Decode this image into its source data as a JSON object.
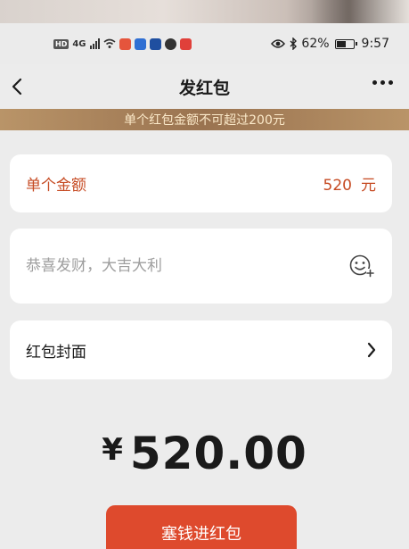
{
  "status_bar": {
    "left_tags": [
      "HD"
    ],
    "network": "4G",
    "battery_percent": "62%",
    "battery_level": 0.62,
    "time": "9:57"
  },
  "nav": {
    "title": "发红包",
    "back_icon": "chevron-left-icon",
    "more_icon": "more-dots-icon"
  },
  "notice": {
    "text": "单个红包金额不可超过200元"
  },
  "amount": {
    "label": "单个金额",
    "value": "520",
    "unit": "元"
  },
  "greeting": {
    "placeholder": "恭喜发财，大吉大利",
    "emoji_icon": "emoji-add-icon"
  },
  "cover": {
    "label": "红包封面",
    "arrow_icon": "chevron-right-icon"
  },
  "total": {
    "currency": "¥",
    "value": "520.00"
  },
  "send_button": {
    "label": "塞钱进红包"
  },
  "colors": {
    "accent_red": "#de4a2d",
    "amount_text": "#c64a22",
    "notice_bg": "#9a7350",
    "notice_text": "#fbe9c9",
    "page_bg": "#ececec"
  }
}
